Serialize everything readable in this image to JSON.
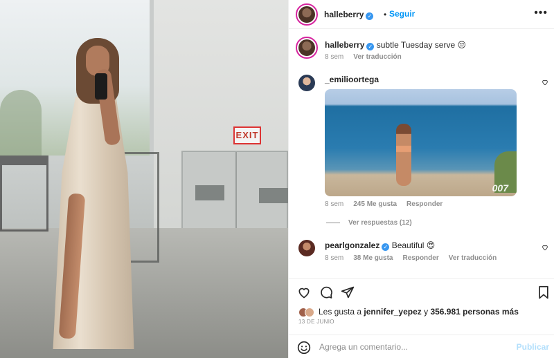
{
  "post_author": {
    "username": "halleberry",
    "verified": true,
    "follow_label": "Seguir",
    "more_icon": "more-horizontal-icon"
  },
  "caption": {
    "username": "halleberry",
    "text": "subtle Tuesday serve 😒",
    "time": "8 sem",
    "translate": "Ver traducción"
  },
  "comments": [
    {
      "username": "_emilioortega",
      "text": "",
      "time": "8 sem",
      "likes": "245 Me gusta",
      "reply": "Responder",
      "gif_watermark": "007",
      "view_replies": "Ver respuestas (12)"
    },
    {
      "username": "pearlgonzalez",
      "verified": true,
      "text": "Beautiful 😍",
      "time": "8 sem",
      "likes": "38 Me gusta",
      "reply": "Responder",
      "translate": "Ver traducción"
    }
  ],
  "likes": {
    "prefix": "Les gusta a",
    "user": "jennifer_yepez",
    "conjunction": "y",
    "count": "356.981 personas más"
  },
  "date": "13 DE JUNIO",
  "comment_box": {
    "placeholder": "Agrega un comentario...",
    "publish_label": "Publicar"
  },
  "photo_exit_sign": "EXIT",
  "colors": {
    "link_blue": "#0095f6",
    "verified_blue": "#3897f0",
    "muted": "#8e8e8e",
    "publish_disabled": "#b2dffc"
  }
}
